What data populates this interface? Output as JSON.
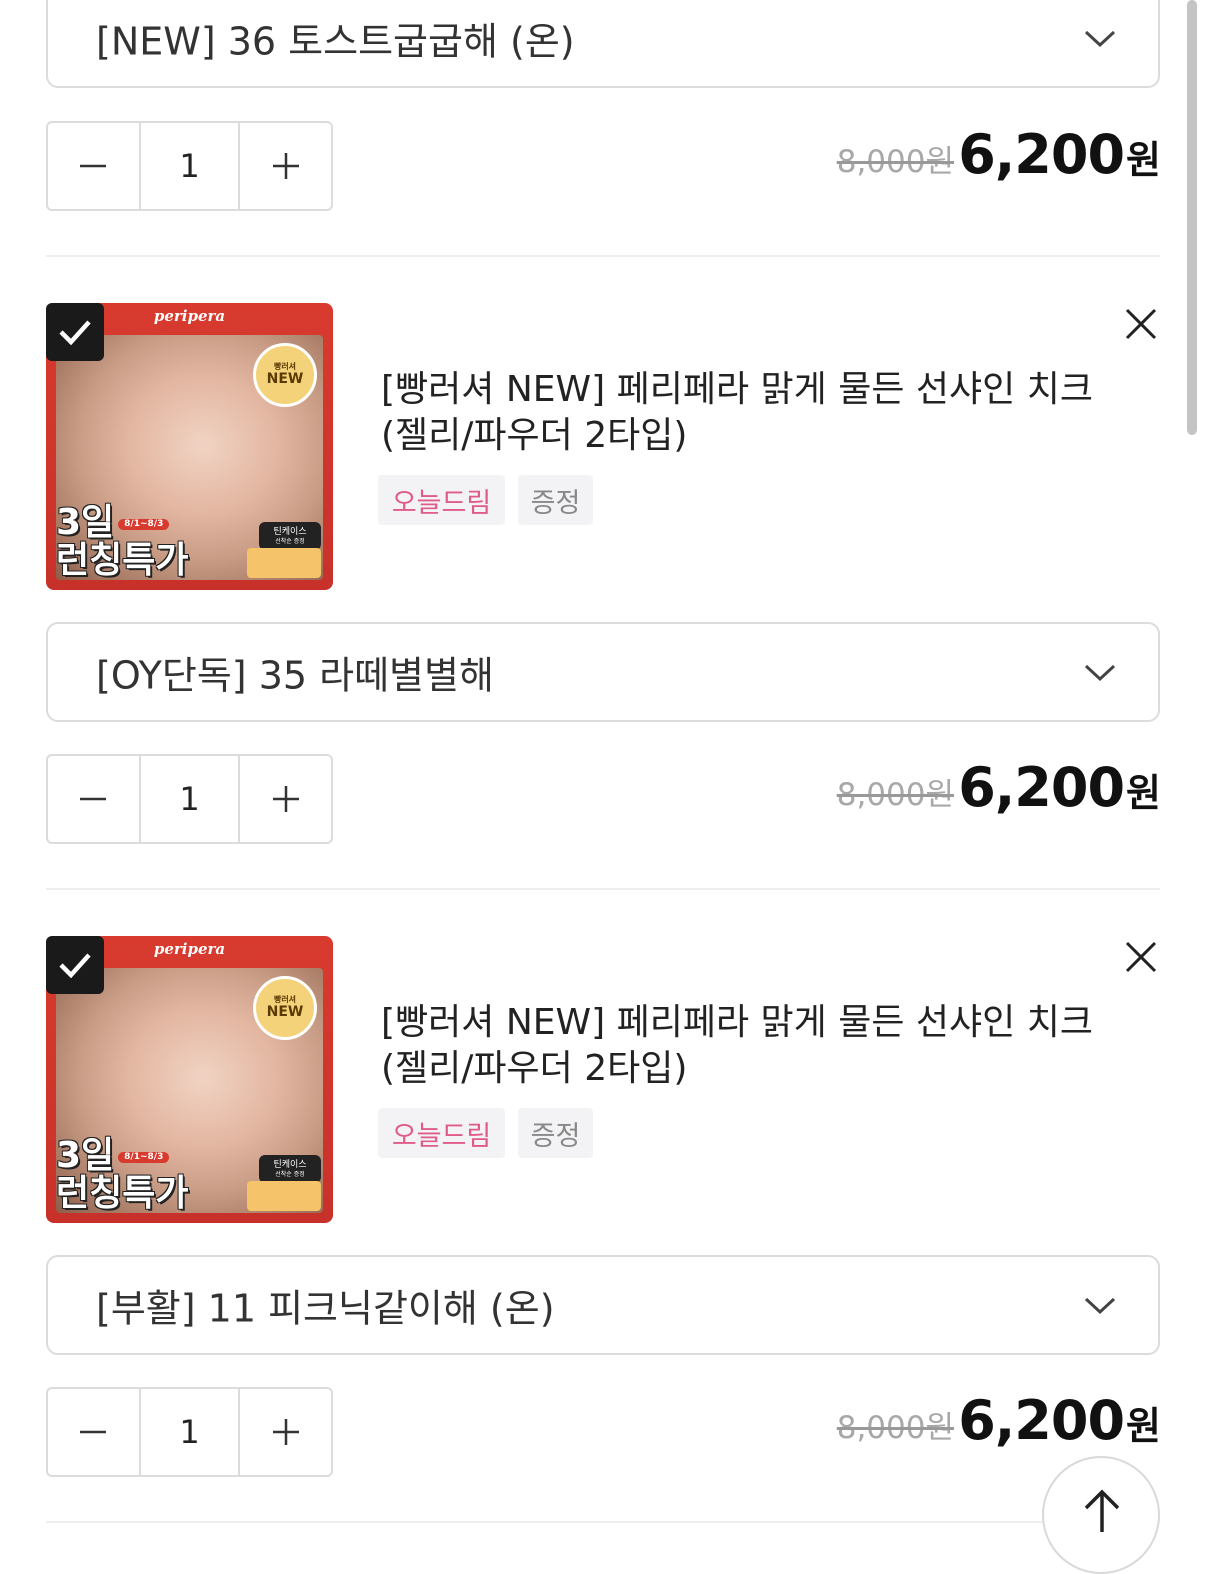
{
  "item_0": {
    "option": "[NEW] 36 토스트굽굽해 (온)",
    "quantity": "1",
    "original_price": "8,000원",
    "sale_price": "6,200",
    "sale_unit": "원"
  },
  "items": [
    {
      "title": "[빵러셔 NEW] 페리페라 맑게 물든 선샤인 치크 (젤리/파우더 2타입)",
      "tags": [
        "오늘드림",
        "증정"
      ],
      "option": "[OY단독] 35 라떼별별해",
      "quantity": "1",
      "original_price": "8,000원",
      "sale_price": "6,200",
      "sale_unit": "원",
      "thumbnail": {
        "brand": "peripera",
        "badge_top": "빵러셔",
        "badge_main": "NEW",
        "promo_line1": "3일",
        "promo_dates": "8/1~8/3",
        "promo_line2": "런칭특가",
        "gift_line1": "틴케이스",
        "gift_line2": "선착순 증정"
      }
    },
    {
      "title": "[빵러셔 NEW] 페리페라 맑게 물든 선샤인 치크 (젤리/파우더 2타입)",
      "tags": [
        "오늘드림",
        "증정"
      ],
      "option": "[부활] 11 피크닉같이해 (온)",
      "quantity": "1",
      "original_price": "8,000원",
      "sale_price": "6,200",
      "sale_unit": "원",
      "thumbnail": {
        "brand": "peripera",
        "badge_top": "빵러셔",
        "badge_main": "NEW",
        "promo_line1": "3일",
        "promo_dates": "8/1~8/3",
        "promo_line2": "런칭특가",
        "gift_line1": "틴케이스",
        "gift_line2": "선착순 증정"
      }
    }
  ],
  "icons": {
    "select": "chevron-down-icon",
    "minus": "minus-icon",
    "plus": "plus-icon",
    "remove": "close-icon",
    "check": "checkmark-icon",
    "scroll_top": "arrow-up-icon"
  },
  "colors": {
    "tag_today_dream": "#e05b8c",
    "tag_gift": "#888888",
    "thumbnail_bg": "#d83a2e",
    "checkbox": "#1a1a1a"
  }
}
